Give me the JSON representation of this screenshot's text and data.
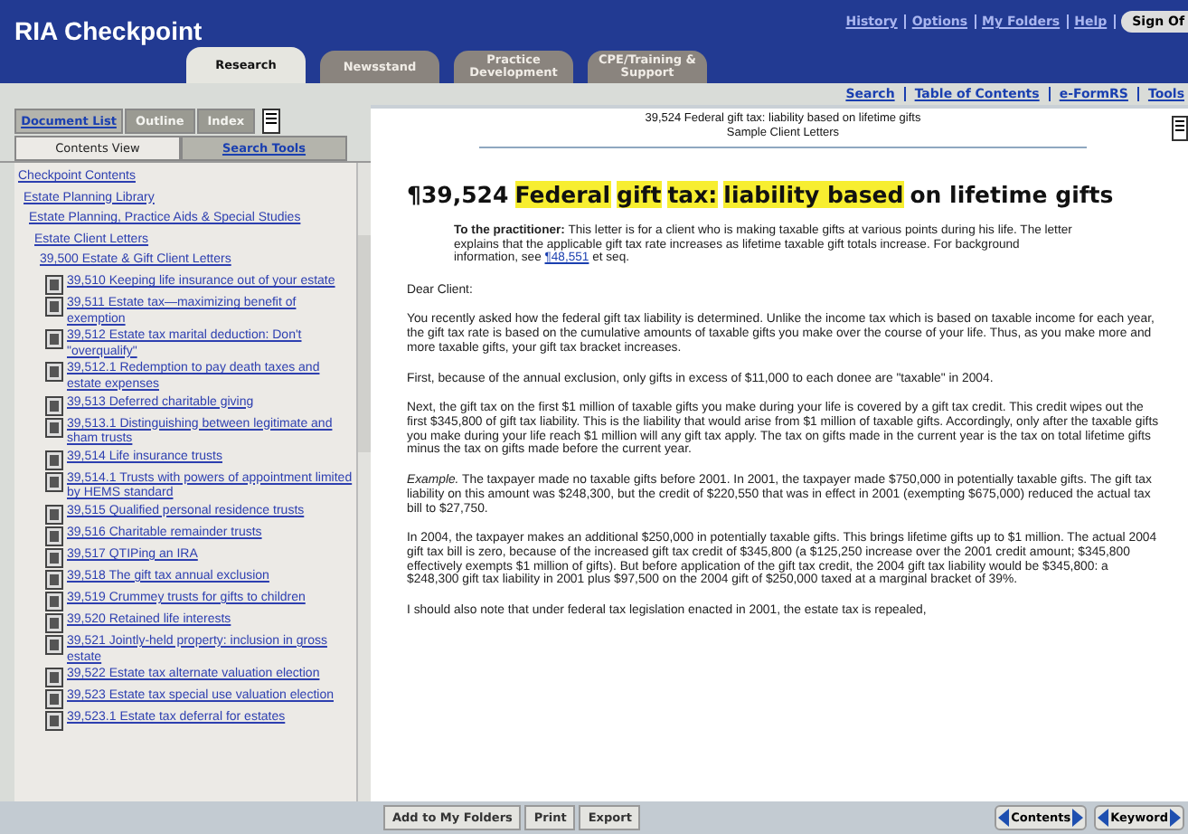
{
  "header": {
    "logo": "RIA Checkpoint",
    "links": [
      "History",
      "Options",
      "My Folders",
      "Help"
    ],
    "sign_off": "Sign Of"
  },
  "tabs": [
    {
      "label": "Research",
      "selected": true
    },
    {
      "label": "Newsstand",
      "selected": false
    },
    {
      "label": "Practice Development",
      "selected": false
    },
    {
      "label": "CPE/Training & Support",
      "selected": false
    }
  ],
  "subnav": [
    "Search",
    "Table of Contents",
    "e-FormRS",
    "Tools"
  ],
  "left_panel": {
    "top_tabs": [
      {
        "label": "Document List",
        "disabled": false
      },
      {
        "label": "Outline",
        "disabled": true
      },
      {
        "label": "Index",
        "disabled": true
      }
    ],
    "view_tabs": [
      {
        "label": "Contents View",
        "selected": true
      },
      {
        "label": "Search Tools",
        "selected": false
      }
    ],
    "tree": [
      {
        "label": "Checkpoint Contents",
        "kind": "folder",
        "children": [
          {
            "label": "Estate Planning Library",
            "kind": "folder",
            "children": [
              {
                "label": "Estate Planning, Practice Aids & Special Studies",
                "kind": "folder",
                "children": [
                  {
                    "label": "Estate Client Letters",
                    "kind": "folder",
                    "children": [
                      {
                        "label": "39,500 Estate & Gift Client Letters",
                        "kind": "folder",
                        "children": [
                          {
                            "label": "39,510 Keeping life insurance out of your estate",
                            "kind": "document"
                          },
                          {
                            "label": "39,511 Estate tax—maximizing benefit of exemption",
                            "kind": "document"
                          },
                          {
                            "label": "39,512 Estate tax marital deduction: Don't \"overqualify\"",
                            "kind": "document"
                          },
                          {
                            "label": "39,512.1 Redemption to pay death taxes and estate expenses",
                            "kind": "document"
                          },
                          {
                            "label": "39,513 Deferred charitable giving",
                            "kind": "document"
                          },
                          {
                            "label": "39,513.1 Distinguishing between legitimate and sham trusts",
                            "kind": "document"
                          },
                          {
                            "label": "39,514 Life insurance trusts",
                            "kind": "document"
                          },
                          {
                            "label": "39,514.1 Trusts with powers of appointment limited by HEMS standard",
                            "kind": "document"
                          },
                          {
                            "label": "39,515 Qualified personal residence trusts",
                            "kind": "document"
                          },
                          {
                            "label": "39,516 Charitable remainder trusts",
                            "kind": "document"
                          },
                          {
                            "label": "39,517 QTIPing an IRA",
                            "kind": "document"
                          },
                          {
                            "label": "39,518 The gift tax annual exclusion",
                            "kind": "document"
                          },
                          {
                            "label": "39,519 Crummey trusts for gifts to children",
                            "kind": "document"
                          },
                          {
                            "label": "39,520 Retained life interests",
                            "kind": "document"
                          },
                          {
                            "label": "39,521 Jointly-held property: inclusion in gross estate",
                            "kind": "document"
                          },
                          {
                            "label": "39,522 Estate tax alternate valuation election",
                            "kind": "document"
                          },
                          {
                            "label": "39,523 Estate tax special use valuation election",
                            "kind": "document"
                          },
                          {
                            "label": "39,523.1 Estate tax deferral for estates",
                            "kind": "document"
                          }
                        ]
                      }
                    ]
                  }
                ]
              }
            ]
          }
        ]
      }
    ]
  },
  "document": {
    "header_lines": [
      "39,524 Federal gift tax: liability based on lifetime gifts",
      "Sample Client Letters"
    ],
    "title_parts": [
      {
        "text": "¶39,524",
        "highlight": false
      },
      {
        "text": "Federal",
        "highlight": true
      },
      {
        "text": "gift",
        "highlight": true
      },
      {
        "text": "tax:",
        "highlight": true
      },
      {
        "text": "liability based",
        "highlight": true
      },
      {
        "text": "on lifetime gifts",
        "highlight": false
      }
    ],
    "practitioner": {
      "text": "**To the practitioner:** This letter is for a client who is making taxable gifts at various points during his life. The letter explains that the applicable gift tax rate increases as lifetime taxable gift totals increase. For background information, see ",
      "link": "¶48,551",
      "after": " et seq."
    },
    "paragraphs": [
      "Dear Client:",
      "You recently asked how the federal gift tax liability is determined. Unlike the income tax which is based on taxable income for each year, the gift tax rate is based on the cumulative amounts of taxable gifts you make over the course of your life. Thus, as you make more and more taxable gifts, your gift tax bracket increases.",
      "First, because of the annual exclusion, only gifts in excess of $11,000 to each donee are \"taxable\" in 2004.",
      "Next, the gift tax on the first $1 million of taxable gifts you make during your life is covered by a gift tax credit. This credit wipes out the first $345,800 of gift tax liability. This is the liability that would arise from $1 million of taxable gifts. Accordingly, only after the taxable gifts you make during your life reach $1 million will any gift tax apply. The tax on gifts made in the current year is the tax on total lifetime gifts minus the tax on gifts made before the current year.",
      "*Example.* The taxpayer made no taxable gifts before 2001. In 2001, the taxpayer made $750,000 in potentially taxable gifts. The gift tax liability on this amount was $248,300, but the credit of $220,550 that was in effect in 2001 (exempting $675,000) reduced the actual tax bill to $27,750.",
      "In 2004, the taxpayer makes an additional $250,000 in potentially taxable gifts. This brings lifetime gifts up to $1 million. The actual 2004 gift tax bill is zero, because of the increased gift tax credit of $345,800 (a $125,250 increase over the 2001 credit amount; $345,800 effectively exempts $1 million of gifts). But before application of the gift tax credit, the 2004 gift tax liability would be $345,800: a $248,300 gift tax liability in 2001 plus $97,500 on the 2004 gift of $250,000 taxed at a marginal bracket of 39%.",
      "I should also note that under federal tax legislation enacted in 2001, the estate tax is repealed,"
    ]
  },
  "toolbar": {
    "buttons": [
      "Add to My Folders",
      "Print",
      "Export"
    ],
    "nav": [
      "Contents",
      "Keyword"
    ]
  }
}
